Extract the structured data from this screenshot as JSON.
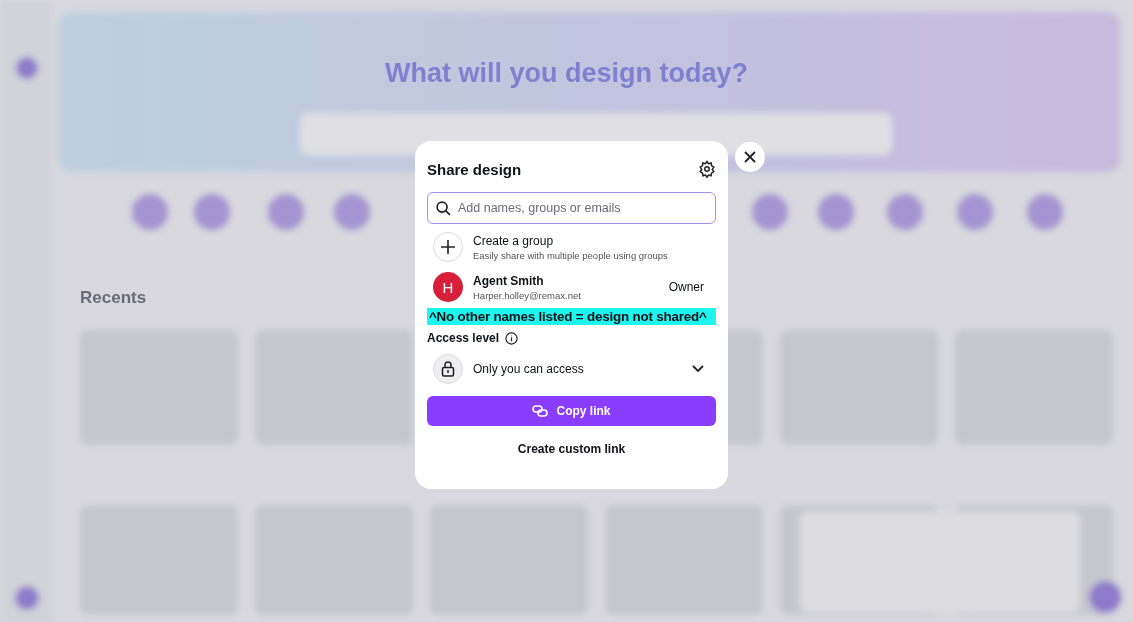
{
  "background": {
    "headline": "What will you design today?",
    "section_title": "Recents"
  },
  "dialog": {
    "title": "Share design",
    "search": {
      "placeholder": "Add names, groups or emails"
    },
    "create_group": {
      "title": "Create a group",
      "subtitle": "Easily share with multiple people using groups"
    },
    "people": [
      {
        "initial": "H",
        "name": "Agent Smith",
        "email": "Harper.holley@remax.net",
        "role": "Owner"
      }
    ],
    "annotation": "^No other names listed = design not shared^",
    "access": {
      "label": "Access level",
      "value": "Only you can access"
    },
    "primary_button": "Copy link",
    "secondary_button": "Create custom link"
  }
}
